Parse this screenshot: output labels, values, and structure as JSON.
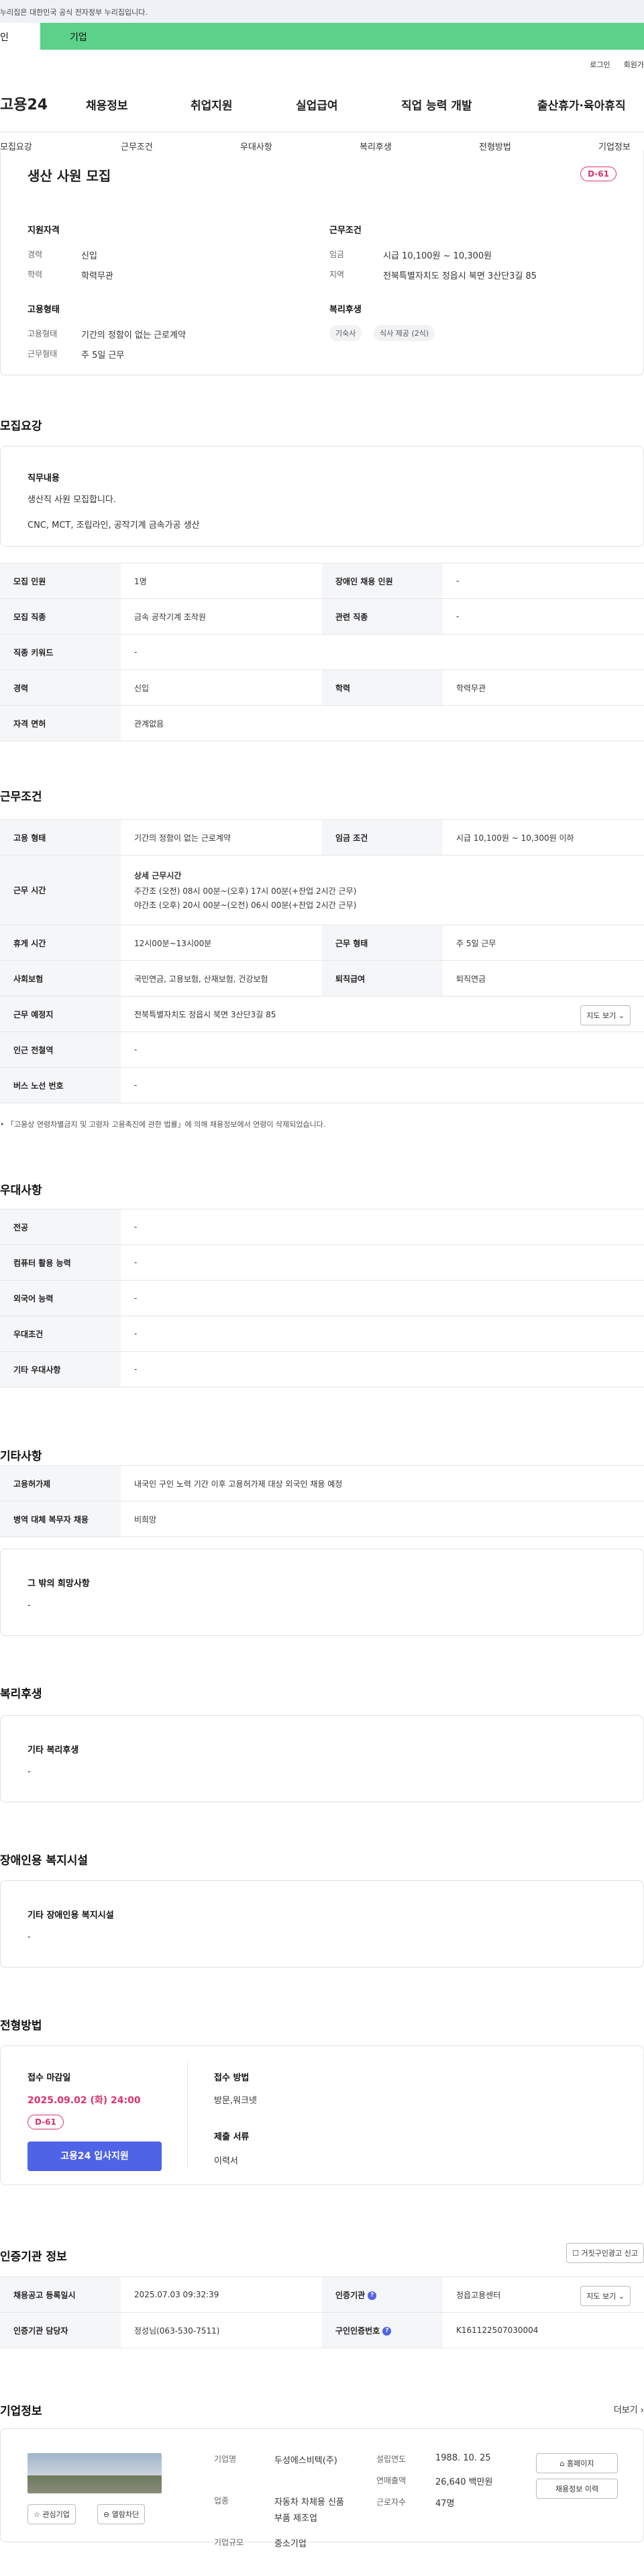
{
  "gov_notice": "누리집은 대한민국 공식 전자정부 누리집입니다.",
  "top_tabs": [
    "인",
    "기업"
  ],
  "util": [
    "로그인",
    "회원가"
  ],
  "logo": "고용24",
  "gnb": [
    "채용정보",
    "취업지원",
    "실업급여",
    "직업 능력 개발",
    "출산휴가·육아휴직"
  ],
  "subnav": [
    "모집요강",
    "근무조건",
    "우대사항",
    "복리후생",
    "전형방법",
    "기업정보"
  ],
  "job": {
    "title": "생산 사원 모집",
    "dday": "D-61",
    "qual_title": "지원자격",
    "career_label": "경력",
    "career": "신입",
    "edu_label": "학력",
    "edu": "학력무관",
    "cond_title": "근무조건",
    "wage_label": "임금",
    "wage": "시급 10,100원 ~ 10,300원",
    "region_label": "지역",
    "region": "전북특별자치도 정읍시 북면 3산단3길 85",
    "emp_title": "고용형태",
    "emp_label": "고용형태",
    "emp": "기간의 정함이 없는 근로계약",
    "days_label": "근무형태",
    "days": "주 5일 근무",
    "welfare_title": "복리후생",
    "chips": [
      "기숙사",
      "식사 제공 (2식)"
    ]
  },
  "recruit": {
    "heading": "모집요강",
    "duty_title": "직무내용",
    "duty_lines": [
      "생산직 사원 모집합니다.",
      "CNC, MCT, 조립라인, 공작기계 금속가공 생산"
    ],
    "rows": {
      "count_label": "모집 인원",
      "count": "1명",
      "disabled_label": "장애인 채용 인원",
      "disabled": "-",
      "field_label": "모집 직종",
      "field": "금속 공작기계 조작원",
      "related_label": "관련 직종",
      "related": "-",
      "keyword_label": "직종 키워드",
      "keyword": "-",
      "career_label": "경력",
      "career": "신입",
      "edu_label": "학력",
      "edu": "학력무관",
      "license_label": "자격 면허",
      "license": "관계없음"
    }
  },
  "work": {
    "heading": "근무조건",
    "type_label": "고용 형태",
    "type": "기간의 정함이 없는 근로계약",
    "wage_label": "임금 조건",
    "wage": "시급 10,100원 ~ 10,300원 이하",
    "hours_label": "근무 시간",
    "hours_title": "상세 근무시간",
    "hours_day": "주간조 (오전) 08시 00분~(오후) 17시 00분(+잔업 2시간 근무)",
    "hours_night": "야간조 (오후) 20시 00분~(오전) 06시 00분(+잔업 2시간 근무)",
    "rest_label": "휴게 시간",
    "rest": "12시00분~13시00분",
    "form_label": "근무 형태",
    "form": "주 5일 근무",
    "insurance_label": "사회보험",
    "insurance": "국민연금, 고용보험, 산재보험, 건강보험",
    "pension_label": "퇴직급여",
    "pension": "퇴직연금",
    "place_label": "근무 예정지",
    "place": "전북특별자치도 정읍시 북면 3산단3길 85",
    "map_btn": "지도 보기",
    "subway_label": "인근 전철역",
    "subway": "-",
    "bus_label": "버스 노선 번호",
    "bus": "-",
    "notice": "「고용상 연령차별금지 및 고령자 고용촉진에 관한 법률」에 의해 채용정보에서 연령이 삭제되었습니다."
  },
  "pref": {
    "heading": "우대사항",
    "rows": [
      {
        "label": "전공",
        "value": "-"
      },
      {
        "label": "컴퓨터 활용 능력",
        "value": "-"
      },
      {
        "label": "외국어 능력",
        "value": "-"
      },
      {
        "label": "우대조건",
        "value": "-"
      },
      {
        "label": "기타 우대사항",
        "value": "-"
      }
    ]
  },
  "etc": {
    "heading": "기타사항",
    "rows": [
      {
        "label": "고용허가제",
        "value": "내국인 구인 노력 기간 이후 고용허가제 대상 외국인 채용 예정"
      },
      {
        "label": "병역 대체 복무자 채용",
        "value": "비희망"
      }
    ],
    "other_title": "그 밖의 희망사항",
    "other_value": "-"
  },
  "welfare": {
    "heading": "복리후생",
    "title": "기타 복리후생",
    "value": "-"
  },
  "facility": {
    "heading": "장애인용 복지시설",
    "title": "기타 장애인용 복지시설",
    "value": "-"
  },
  "process": {
    "heading": "전형방법",
    "deadline_title": "접수 마감일",
    "deadline": "2025.09.02 (화) 24:00",
    "dday": "D-61",
    "apply": "고용24 입사지원",
    "method_title": "접수 방법",
    "method": "방문,워크넷",
    "docs_title": "제출 서류",
    "docs": "이력서"
  },
  "cert": {
    "heading": "인증기관 정보",
    "report_btn": "거짓구인광고 신고",
    "reg_label": "채용공고 등록일시",
    "reg": "2025.07.03 09:32:39",
    "agency_label": "인증기관",
    "agency": "정읍고용센터",
    "map_btn": "지도 보기",
    "manager_label": "인증기관 담당자",
    "manager": "정성님(063-530-7511)",
    "no_label": "구인인증번호",
    "no": "K161122507030004"
  },
  "company": {
    "heading": "기업정보",
    "more": "더보기",
    "interest_btn": "관심기업",
    "block_btn": "열람차단",
    "name_label": "기업명",
    "name": "두성에스비텍(주)",
    "industry_label": "업종",
    "industry": "자동차 차체용 신품 부품 제조업",
    "scale_label": "기업규모",
    "scale": "중소기업",
    "founded_label": "설립연도",
    "founded": "1988. 10. 25",
    "sales_label": "연매출액",
    "sales": "26,640 백만원",
    "staff_label": "근로자수",
    "staff": "47명",
    "homepage_btn": "홈페이지",
    "history_btn": "채용정보 이력"
  }
}
